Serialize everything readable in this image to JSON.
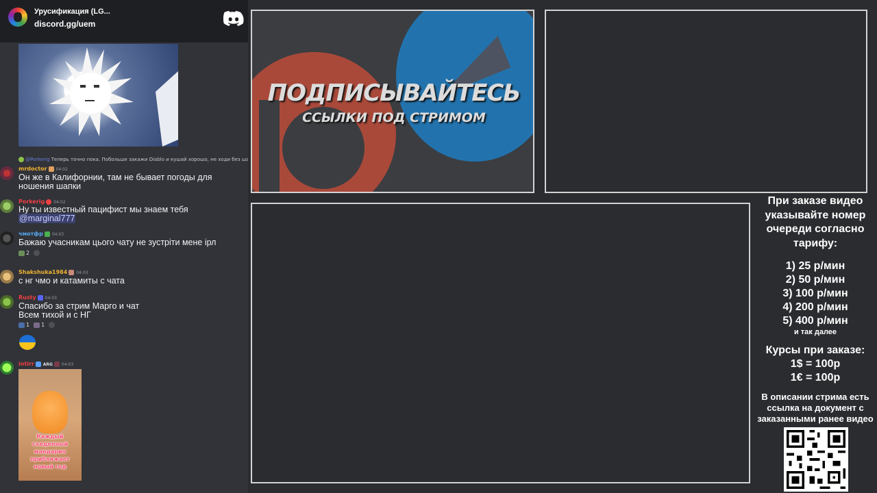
{
  "server": {
    "name": "Урусификация (LG...",
    "invite": "discord.gg/uem"
  },
  "chat": {
    "reply": {
      "mention": "@Porkerig",
      "text": " Теперь точно пока. Побольше закажи Diablo и кушай хорошо, не ходи без шапки !"
    },
    "messages": [
      {
        "author": "mrdoctor",
        "time": "04:02",
        "author_color": "#f0b232",
        "text": "Он же в Калифорнии, там не бывает погоды для ношения шапки"
      },
      {
        "author": "Porkerig",
        "time": "04:02",
        "author_color": "#f23f43",
        "text": "Ну ты известный пацифист мы знаем тебя",
        "mention": "@marginal777"
      },
      {
        "author": "чмотфр",
        "time": "04:03",
        "author_color": "#56a8f0",
        "text": "Бажаю учасникам цього чату не зустріти мене ірл",
        "reaction_count": "2"
      },
      {
        "author": "Shakshuka1984",
        "time": "04:03",
        "author_color": "#f0b232",
        "text": "с нг чмо и катамиты с чата"
      },
      {
        "author": "Rusty",
        "time": "04:03",
        "author_color": "#f23f43",
        "text_line1": "Спасибо за стрим Марго и чат",
        "text_line2": "Всем тихой и с НГ",
        "reaction1": "1",
        "reaction2": "1"
      },
      {
        "author": "intirr",
        "time": "04:03",
        "author_color": "#f23f43",
        "tag": "ARG",
        "image_caption": "Каждый съеденный мандарин приближает новый год"
      }
    ]
  },
  "promo": {
    "headline": "ПОДПИСЫВАЙТЕСЬ",
    "subline": "ССЫЛКИ ПОД СТРИМОМ"
  },
  "info": {
    "order_note": "При заказе видео указывайте номер очереди согласно тарифу:",
    "tariffs": [
      "1) 25 р/мин",
      "2) 50 р/мин",
      "3) 100 р/мин",
      "4) 200 р/мин",
      "5) 400 р/мин"
    ],
    "etc": "и так далее",
    "rates_title": "Курсы при заказе:",
    "rates": [
      "1$ = 100р",
      "1€ = 100р"
    ],
    "doc_note": "В описании стрима есть ссылка на документ с заказанными ранее видео"
  }
}
